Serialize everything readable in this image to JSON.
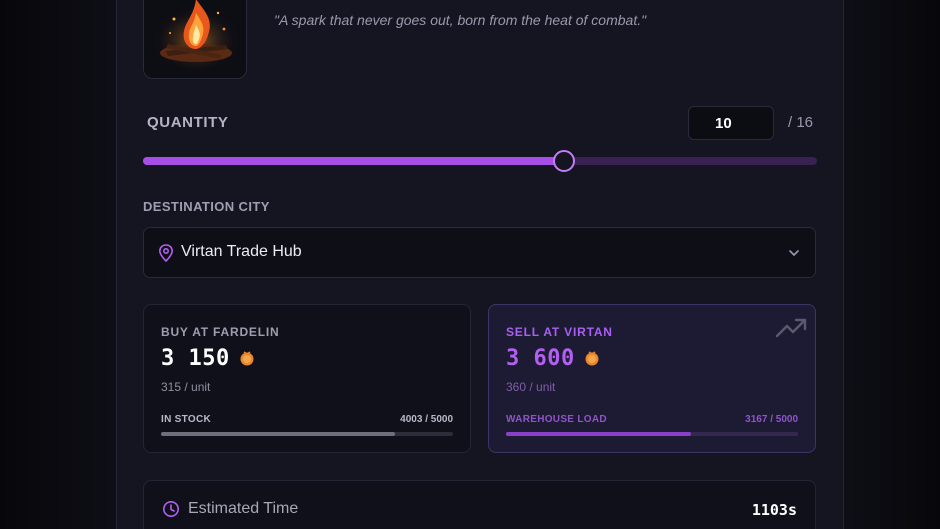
{
  "item": {
    "quote": "\"A spark that never goes out, born from the heat of combat.\""
  },
  "quantity": {
    "label": "QUANTITY",
    "value": "10",
    "max_text": "/ 16",
    "current": 10,
    "max": 16
  },
  "destination": {
    "label": "DESTINATION CITY",
    "selected": "Virtan Trade Hub"
  },
  "buy": {
    "title": "BUY AT FARDELIN",
    "price": "3 150",
    "unit_price": "315 / unit",
    "stock_label": "IN STOCK",
    "stock_value": "4003 / 5000",
    "stock_fraction": 0.8006
  },
  "sell": {
    "title": "SELL AT VIRTAN",
    "price": "3 600",
    "unit_price": "360 / unit",
    "load_label": "WAREHOUSE LOAD",
    "load_value": "3167 / 5000",
    "load_fraction": 0.6334
  },
  "eta": {
    "label": "Estimated Time",
    "value": "1103s"
  },
  "icons": {
    "item": "campfire-item-icon",
    "location": "map-pin-icon",
    "dropdown": "chevron-down-icon",
    "currency": "gold-coin-icon",
    "trend": "trending-up-icon",
    "time": "clock-icon"
  },
  "colors": {
    "accent": "#a74ee6",
    "background": "#151522",
    "sell_card": "#1d1a33",
    "coin": "#e8872c"
  }
}
